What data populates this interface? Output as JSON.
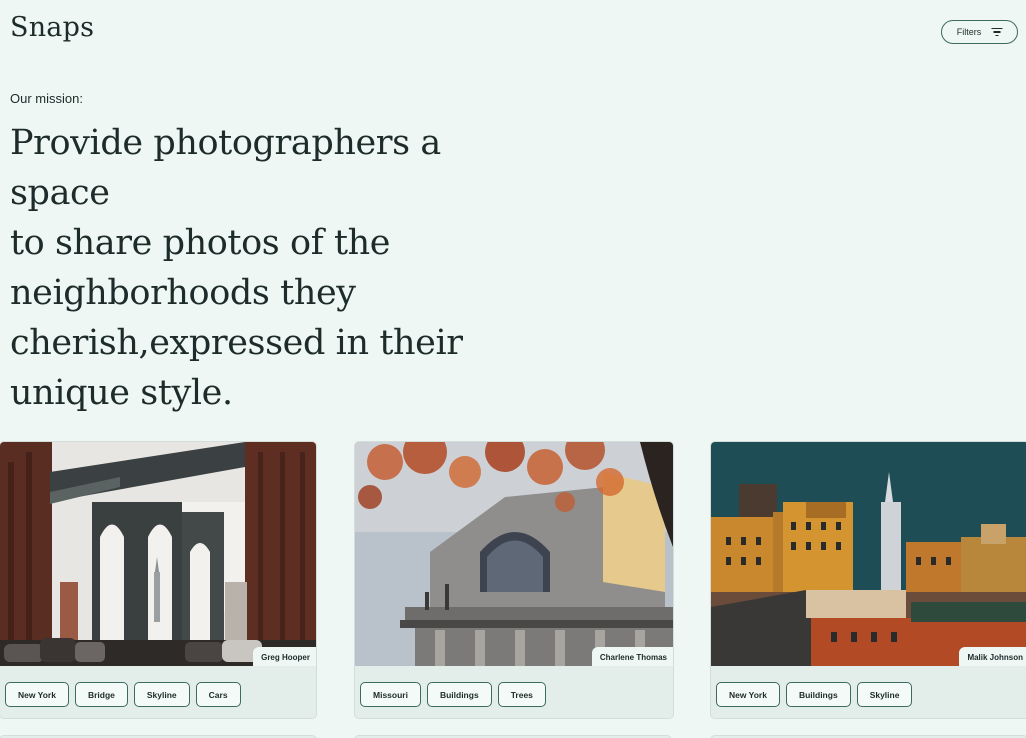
{
  "header": {
    "brand": "Snaps",
    "filters_label": "Filters"
  },
  "mission": {
    "label": "Our mission:",
    "lines": [
      "Provide photographers a space",
      "to share photos of the",
      "neighborhoods they",
      "cherish,expressed in their",
      "unique style."
    ]
  },
  "cards": [
    {
      "photographer": "Greg Hooper",
      "tags": [
        "New York",
        "Bridge",
        "Skyline",
        "Cars"
      ]
    },
    {
      "photographer": "Charlene Thomas",
      "tags": [
        "Missouri",
        "Buildings",
        "Trees"
      ]
    },
    {
      "photographer": "Malik Johnson",
      "tags": [
        "New York",
        "Buildings",
        "Skyline"
      ]
    }
  ],
  "colors": {
    "background": "#eef7f3",
    "card": "#e3ede9",
    "accent": "#3d6b62",
    "text": "#1d2b2a"
  }
}
